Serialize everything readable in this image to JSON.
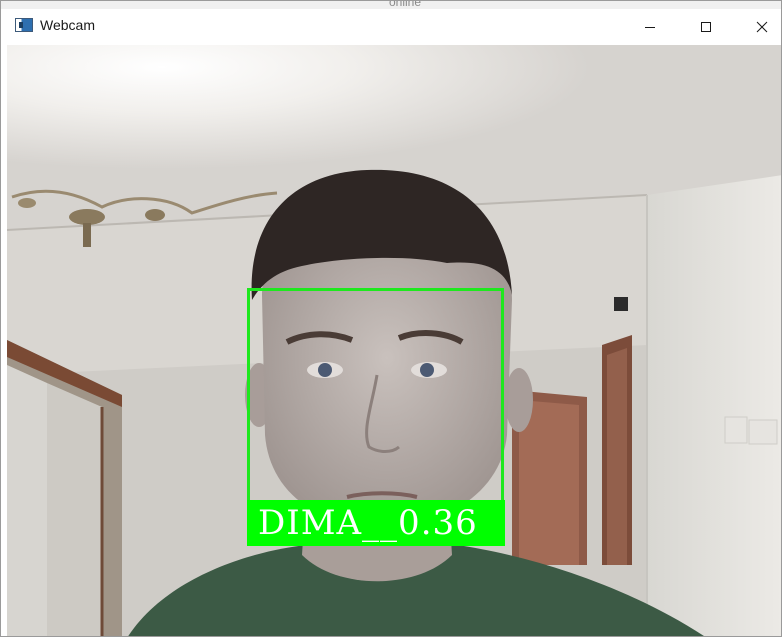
{
  "background_window": {
    "partial_text": "online"
  },
  "window": {
    "title": "Webcam",
    "app_icon": "webcam-window-icon",
    "controls": {
      "minimize_icon": "minimize-icon",
      "maximize_icon": "maximize-icon",
      "close_icon": "close-icon"
    }
  },
  "detection": {
    "label": "DIMA__0.36",
    "box_color": "#1ee81e",
    "label_bg_color": "#00ff00",
    "label_text_color": "#ffffff"
  }
}
